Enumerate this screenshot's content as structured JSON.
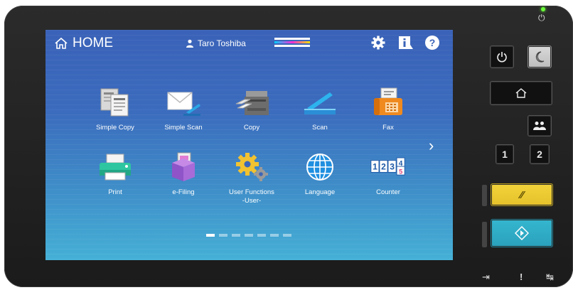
{
  "header": {
    "title": "HOME",
    "user": "Taro Toshiba"
  },
  "apps_row1": [
    {
      "label": "Simple Copy",
      "icon": "simple-copy-icon"
    },
    {
      "label": "Simple Scan",
      "icon": "simple-scan-icon"
    },
    {
      "label": "Copy",
      "icon": "copy-icon"
    },
    {
      "label": "Scan",
      "icon": "scan-icon"
    },
    {
      "label": "Fax",
      "icon": "fax-icon"
    }
  ],
  "apps_row2": [
    {
      "label": "Print",
      "icon": "print-icon"
    },
    {
      "label": "e-Filing",
      "icon": "e-filing-icon"
    },
    {
      "label": "User Functions",
      "label2": "-User-",
      "icon": "user-functions-icon"
    },
    {
      "label": "Language",
      "icon": "language-icon"
    },
    {
      "label": "Counter",
      "icon": "counter-icon"
    }
  ],
  "counter_digits": [
    "1",
    "2",
    "3",
    "4",
    "5"
  ],
  "pagination": {
    "pages": 7,
    "current": 1
  },
  "side_buttons": {
    "job1": "1",
    "job2": "2"
  },
  "colors": {
    "screen_top": "#3a62b8",
    "screen_bottom": "#45b0d6",
    "reset_button": "#f2d23a",
    "start_button": "#35b6cf",
    "power_led": "#6bff3a"
  }
}
